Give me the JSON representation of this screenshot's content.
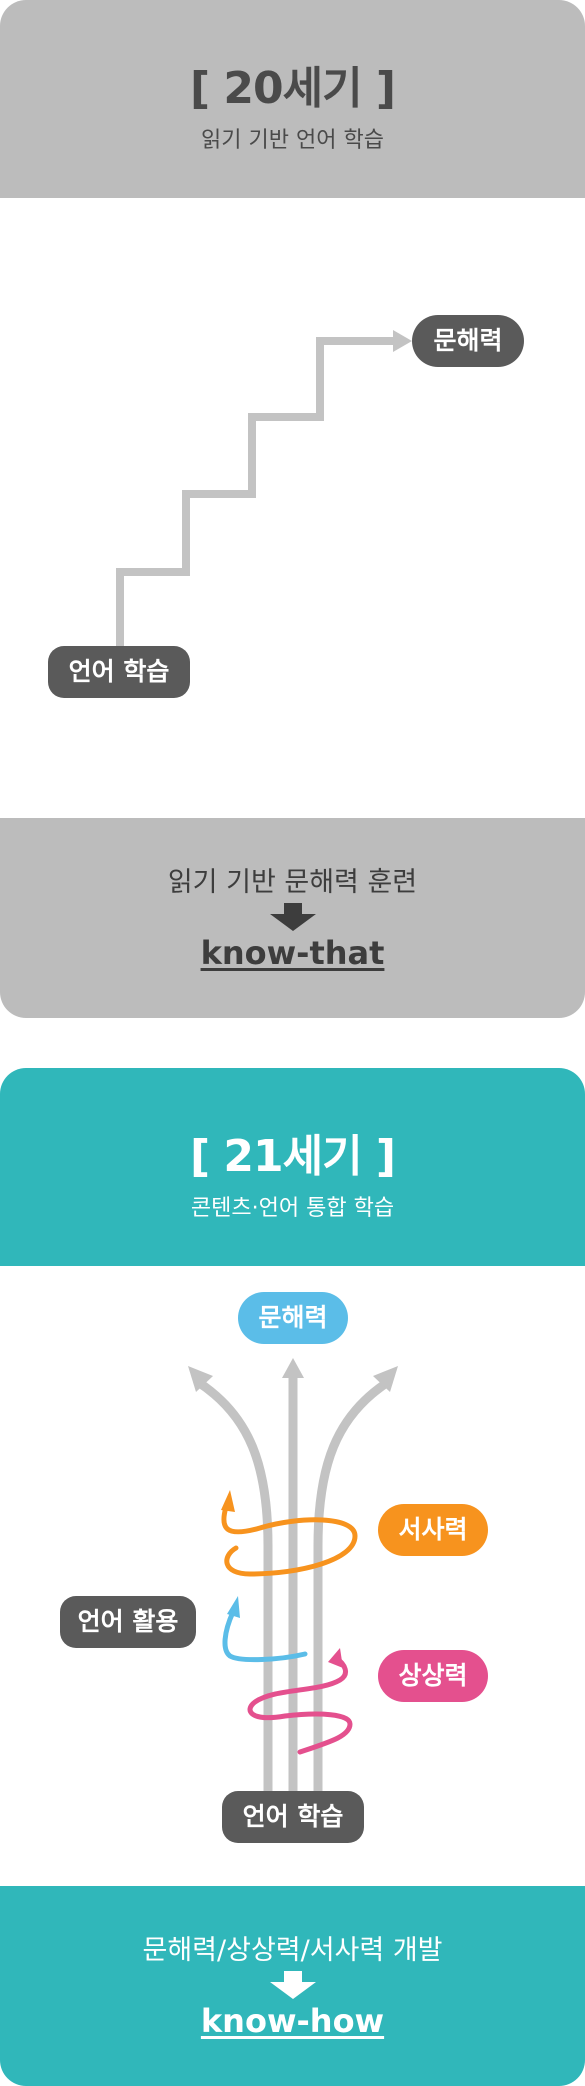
{
  "century20": {
    "title": "[ 20세기 ]",
    "subtitle": "읽기 기반 언어 학습",
    "start_label": "언어 학습",
    "goal_label": "문해력",
    "caption": "읽기 기반 문해력 훈련",
    "keyword": "know-that"
  },
  "century21": {
    "title": "[ 21세기 ]",
    "subtitle": "콘텐츠·언어 통합 학습",
    "start_label": "언어 학습",
    "usage_label": "언어 활용",
    "goal_label": "문해력",
    "narrative_label": "서사력",
    "imagination_label": "상상력",
    "caption": "문해력/상상력/서사력 개발",
    "keyword": "know-how"
  },
  "colors": {
    "gray_band": "#bcbcbc",
    "teal_band": "#30b7ba",
    "dark_pill": "#5a5a5a",
    "light_arrow": "#c3c3c3",
    "sky_blue": "#5bbde8",
    "orange": "#f7931e",
    "pink": "#e4508e"
  }
}
